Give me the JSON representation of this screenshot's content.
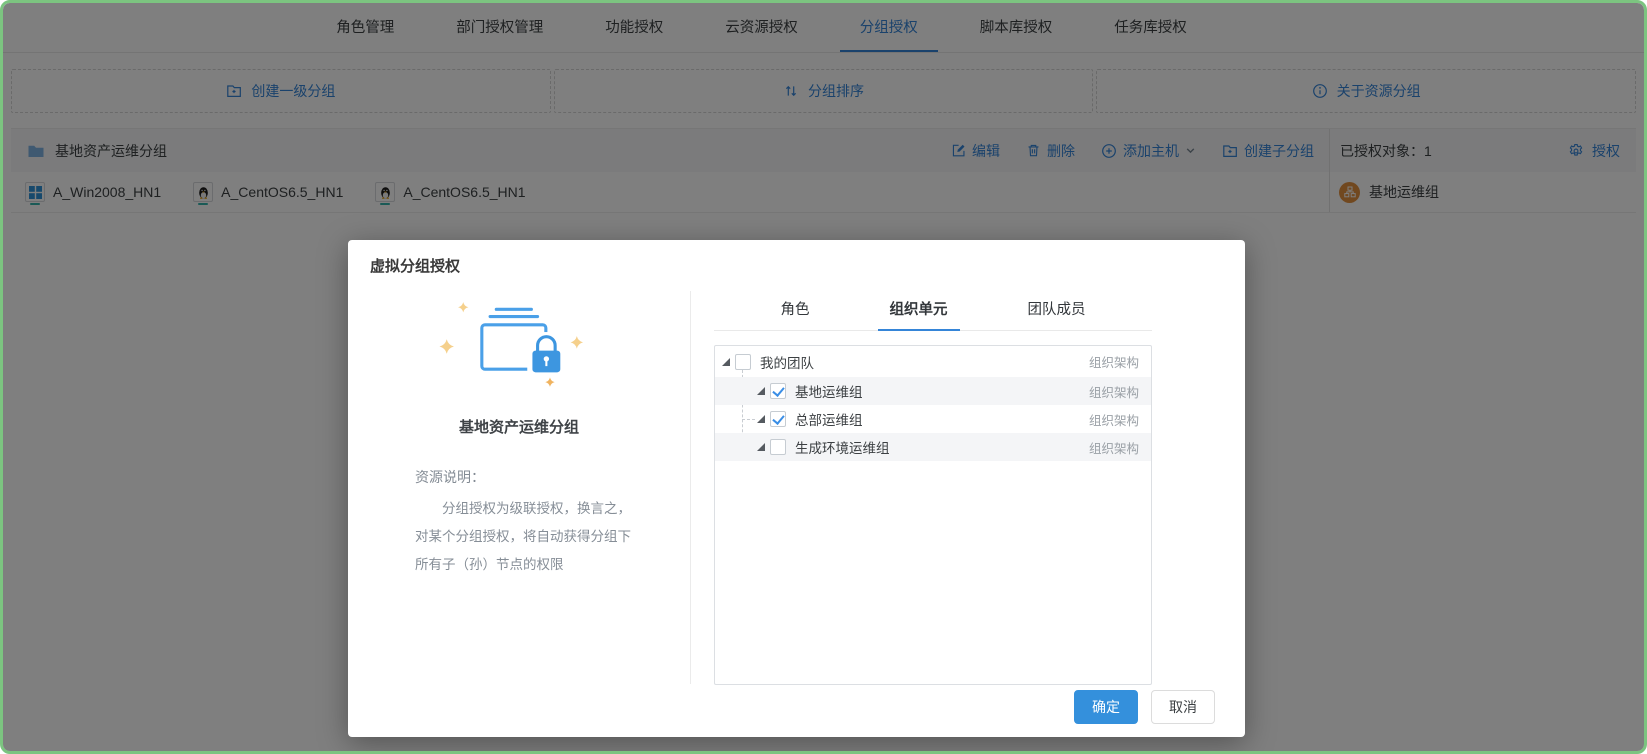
{
  "window": {
    "frame_color": "#7cc480"
  },
  "tabs": {
    "items": [
      {
        "label": "角色管理"
      },
      {
        "label": "部门授权管理"
      },
      {
        "label": "功能授权"
      },
      {
        "label": "云资源授权"
      },
      {
        "label": "分组授权",
        "active": true
      },
      {
        "label": "脚本库授权"
      },
      {
        "label": "任务库授权"
      }
    ]
  },
  "toolbar": {
    "buttons": [
      {
        "icon": "folder-plus-icon",
        "label": "创建一级分组"
      },
      {
        "icon": "sort-icon",
        "label": "分组排序"
      },
      {
        "icon": "info-icon",
        "label": "关于资源分组"
      }
    ]
  },
  "group_panel": {
    "group_name": "基地资产运维分组",
    "actions": {
      "edit": "编辑",
      "delete": "删除",
      "add_host": "添加主机",
      "create_subgroup": "创建子分组",
      "authorize": "授权"
    },
    "authorized_count": "已授权对象：1",
    "hosts": [
      {
        "name": "A_Win2008_HN1",
        "os": "windows"
      },
      {
        "name": "A_CentOS6.5_HN1",
        "os": "linux"
      },
      {
        "name": "A_CentOS6.5_HN1",
        "os": "linux"
      }
    ],
    "authorized_objects": [
      {
        "name": "基地运维组"
      }
    ]
  },
  "modal": {
    "title": "虚拟分组授权",
    "illustration_group_name": "基地资产运维分组",
    "description_label": "资源说明：",
    "description": "分组授权为级联授权，换言之，对某个分组授权，将自动获得分组下所有子（孙）节点的权限",
    "tabs": [
      {
        "label": "角色"
      },
      {
        "label": "组织单元",
        "active": true
      },
      {
        "label": "团队成员"
      }
    ],
    "tree": [
      {
        "label": "我的团队",
        "type_label": "组织架构",
        "checked": false,
        "level": 0
      },
      {
        "label": "基地运维组",
        "type_label": "组织架构",
        "checked": true,
        "level": 1
      },
      {
        "label": "总部运维组",
        "type_label": "组织架构",
        "checked": true,
        "level": 1
      },
      {
        "label": "生成环境运维组",
        "type_label": "组织架构",
        "checked": false,
        "level": 1
      }
    ],
    "ok_label": "确定",
    "cancel_label": "取消"
  },
  "colors": {
    "accent_blue": "#3585d8",
    "primary_button_blue": "#3490dc",
    "avatar_orange": "#e2903f",
    "frame_green": "#7cc480",
    "host_base_teal": "#35b5ad"
  }
}
